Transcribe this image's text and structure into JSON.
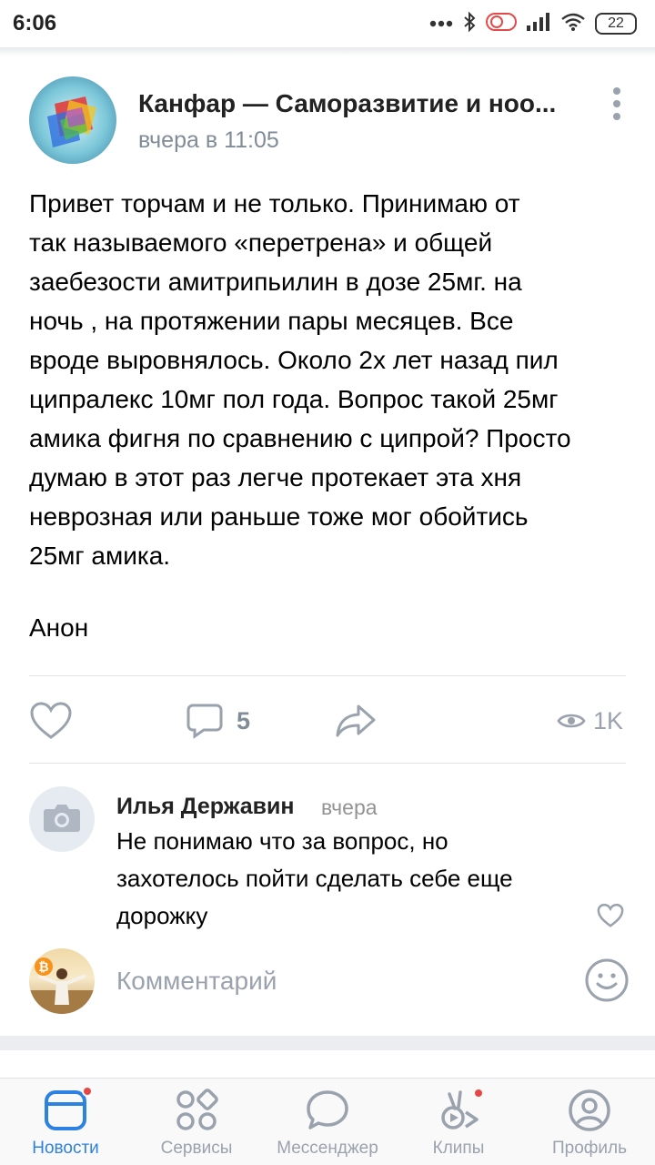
{
  "status_bar": {
    "time": "6:06",
    "battery": "22"
  },
  "post": {
    "group_name": "Канфар — Саморазвитие и ноо...",
    "time": "вчера в 11:05",
    "text_lines": [
      "Привет торчам и не только. Принимаю от",
      "так называемого «перетрена» и общей",
      "заебезости амитрипьилин в дозе 25мг. на",
      "ночь , на протяжении пары месяцев. Все",
      "вроде выровнялось. Около 2х лет назад пил",
      "ципралекс 10мг пол года. Вопрос такой 25мг",
      "амика фигня по сравнению с ципрой? Просто",
      "думаю в этот раз легче протекает эта хня",
      "неврозная или раньше тоже мог обойтись",
      "25мг амика."
    ],
    "signature": "Анон",
    "comments_count": "5",
    "views": "1K"
  },
  "comment": {
    "author": "Илья Державин",
    "when": "вчера",
    "text_lines": [
      "Не понимаю что за вопрос, но",
      "захотелось пойти сделать себе еще",
      "дорожку"
    ]
  },
  "composer": {
    "placeholder": "Комментарий",
    "value": "",
    "avatar_badge": "₿"
  },
  "tabbar": {
    "items": [
      {
        "label": "Новости",
        "active": true,
        "badge": true
      },
      {
        "label": "Сервисы",
        "active": false,
        "badge": false
      },
      {
        "label": "Мессенджер",
        "active": false,
        "badge": false
      },
      {
        "label": "Клипы",
        "active": false,
        "badge": true
      },
      {
        "label": "Профиль",
        "active": false,
        "badge": false
      }
    ]
  },
  "colors": {
    "accent": "#2d81e0",
    "secondary_text": "#818c99",
    "icon_gray": "#99a2ad",
    "badge": "#e64646"
  }
}
